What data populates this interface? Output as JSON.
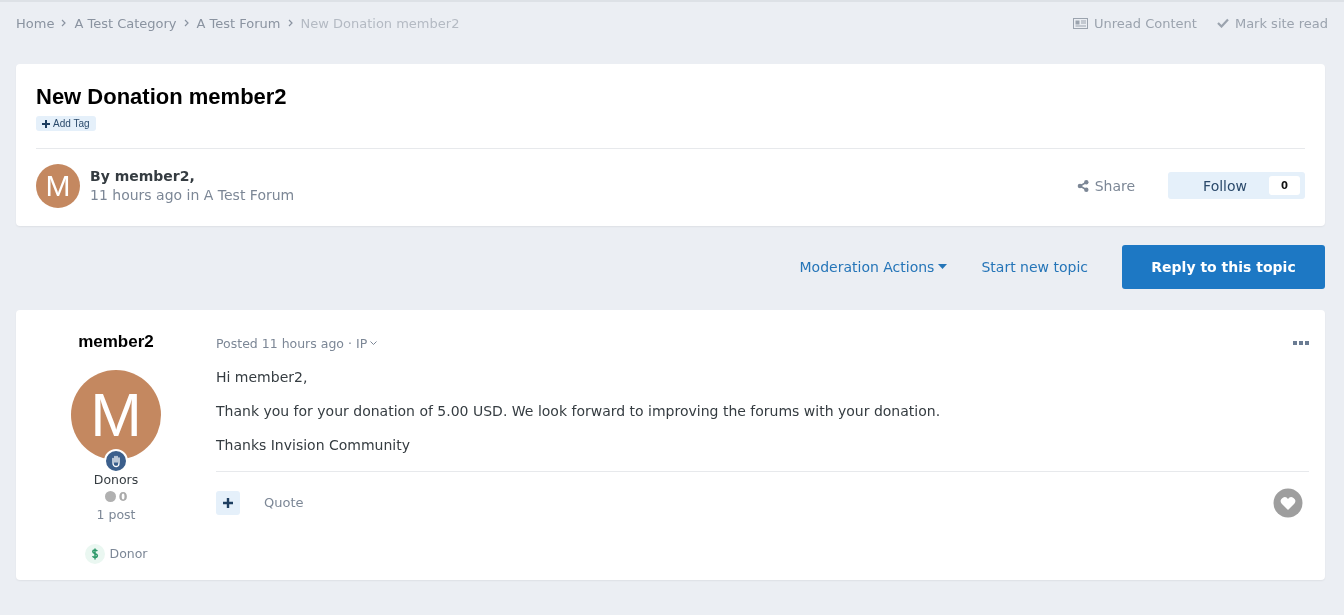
{
  "breadcrumb": [
    {
      "label": "Home",
      "current": false
    },
    {
      "label": "A Test Category",
      "current": false
    },
    {
      "label": "A Test Forum",
      "current": false
    },
    {
      "label": "New Donation member2",
      "current": true
    }
  ],
  "top_links": [
    {
      "kind": "unread",
      "label": "Unread Content"
    },
    {
      "kind": "mark",
      "label": "Mark site read"
    }
  ],
  "topic": {
    "title": "New Donation member2",
    "add_tag": "Add Tag",
    "avatar_letter": "M",
    "author_line": "By member2,",
    "time": "11 hours ago",
    "in_word": "in",
    "forum": "A Test Forum",
    "share": "Share",
    "follow": "Follow",
    "follow_count": "0"
  },
  "actions": {
    "moderation": "Moderation Actions",
    "start": "Start new topic",
    "reply": "Reply to this topic"
  },
  "post": {
    "author": "member2",
    "avatar_letter": "M",
    "group": "Donors",
    "reputation": "0",
    "posts": "1 post",
    "badge": "Donor",
    "posted": "Posted 11 hours ago",
    "separator": "·",
    "ip": "IP",
    "paragraphs": [
      "Hi member2,",
      "Thank you for your donation of 5.00 USD. We look forward to improving the forums with your donation.",
      "Thanks Invision Community"
    ],
    "quote": "Quote"
  }
}
